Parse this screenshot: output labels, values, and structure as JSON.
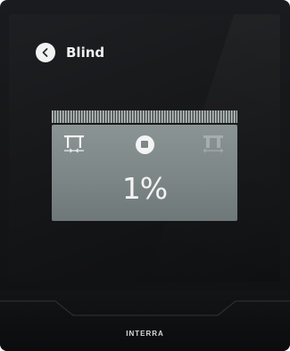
{
  "header": {
    "title": "Blind",
    "back_icon": "chevron-left-icon"
  },
  "blind_control": {
    "position_percent": "1%",
    "close_icon": "blind-close-icon",
    "stop_icon": "stop-icon",
    "open_icon": "blind-open-icon"
  },
  "device": {
    "brand": "INTERRA"
  },
  "colors": {
    "screen_background": "#151618",
    "panel_background": "#7d8686",
    "icon_foreground": "#f4f4f4",
    "disabled_icon": "#9aa2a2"
  }
}
